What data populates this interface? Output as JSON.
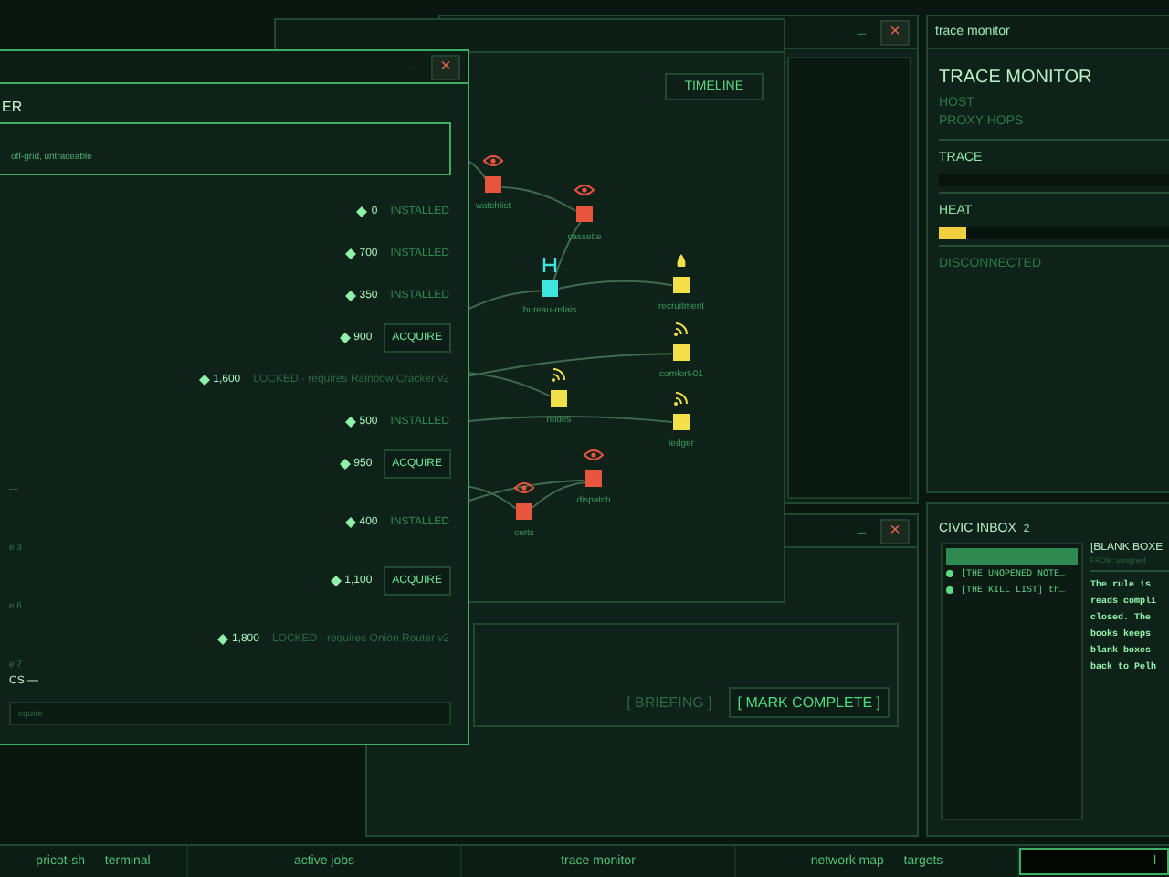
{
  "back_window": {
    "controls": [
      "–",
      "×"
    ]
  },
  "network_map": {
    "timeline_button": "TIMELINE",
    "nodes": [
      {
        "label": "watchlist",
        "kind": "watched"
      },
      {
        "label": "cassette",
        "kind": "watched"
      },
      {
        "label": "bureau-relais",
        "kind": "hub"
      },
      {
        "label": "recruitment",
        "kind": "beacon"
      },
      {
        "label": "comfort-01",
        "kind": "signal"
      },
      {
        "label": "nodes",
        "kind": "signal"
      },
      {
        "label": "ledger",
        "kind": "signal"
      },
      {
        "label": "dispatch",
        "kind": "watched"
      },
      {
        "label": "certs",
        "kind": "watched"
      }
    ]
  },
  "jobs_window": {
    "controls": [
      "–",
      "×"
    ],
    "buttons": [
      {
        "label": "[ BRIEFING ]",
        "enabled": false
      },
      {
        "label": "[ MARK COMPLETE ]",
        "enabled": true
      }
    ]
  },
  "market": {
    "controls": [
      "–",
      "×"
    ],
    "heading": "ER",
    "featured_text": "off-grid, untraceable",
    "entries": [
      {
        "kind": "installed",
        "price": "0",
        "status": "INSTALLED"
      },
      {
        "kind": "installed",
        "price": "700",
        "status": "INSTALLED"
      },
      {
        "kind": "installed",
        "price": "350",
        "status": "INSTALLED"
      },
      {
        "kind": "acquire",
        "price": "900",
        "status": "ACQUIRE"
      },
      {
        "kind": "locked",
        "price": "1,600",
        "status": "LOCKED · requires Rainbow Cracker v2"
      },
      {
        "kind": "installed",
        "price": "500",
        "status": "INSTALLED"
      },
      {
        "kind": "acquire",
        "price": "950",
        "status": "ACQUIRE"
      },
      {
        "kind": "note",
        "text": "—"
      },
      {
        "kind": "installed",
        "price": "400",
        "status": "INSTALLED"
      },
      {
        "kind": "note",
        "text": "e 3"
      },
      {
        "kind": "acquire",
        "price": "1,100",
        "status": "ACQUIRE"
      },
      {
        "kind": "note",
        "text": "e 6"
      },
      {
        "kind": "locked",
        "price": "1,800",
        "status": "LOCKED · requires Onion Router v2"
      },
      {
        "kind": "note",
        "text": "e 7"
      },
      {
        "kind": "section",
        "text": "CS —"
      }
    ],
    "field": {
      "placeholder": "cquire"
    }
  },
  "trace_monitor": {
    "title": "trace monitor",
    "heading": "TRACE MONITOR",
    "host_label": "HOST",
    "hops_label": "PROXY HOPS",
    "meters": [
      {
        "label": "TRACE"
      },
      {
        "label": "HEAT",
        "level": 0.12
      }
    ],
    "status": "DISCONNECTED"
  },
  "civic_inbox": {
    "heading": "CIVIC INBOX",
    "count": "2",
    "messages": [
      {
        "selected": true,
        "unread": false
      },
      {
        "subject": "[THE UNOPENED NOTE…",
        "selected": false,
        "unread": true
      },
      {
        "subject": "[THE KILL LIST] th…",
        "selected": false,
        "unread": true
      }
    ],
    "reader": {
      "title": "[BLANK BOXE",
      "from": "FROM: unsigned",
      "body_lines": [
        "The rule is",
        "reads compli",
        "closed. The",
        "books keeps",
        "blank boxes",
        "back to Pelh"
      ]
    }
  },
  "taskbar": [
    {
      "label": "pricot-sh — terminal",
      "active": false
    },
    {
      "label": "active jobs",
      "active": false
    },
    {
      "label": "trace monitor",
      "active": false
    },
    {
      "label": "network map — targets",
      "active": false
    },
    {
      "label": "l",
      "active": true
    }
  ]
}
